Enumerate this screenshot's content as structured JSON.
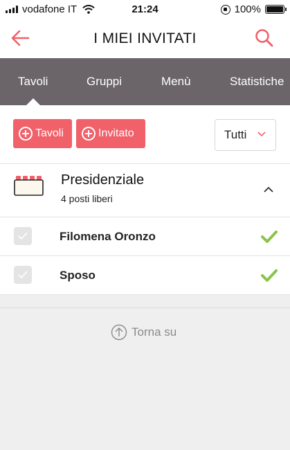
{
  "status_bar": {
    "carrier": "vodafone IT",
    "time": "21:24",
    "battery": "100%"
  },
  "nav": {
    "title": "I MIEI INVITATI"
  },
  "tabs": [
    {
      "label": "Tavoli",
      "active": true
    },
    {
      "label": "Gruppi",
      "active": false
    },
    {
      "label": "Menù",
      "active": false
    },
    {
      "label": "Statistiche",
      "active": false
    }
  ],
  "toolbar": {
    "add_table_label": "Tavoli",
    "add_guest_label": "Invitato",
    "filter_value": "Tutti"
  },
  "table": {
    "name": "Presidenziale",
    "seats_free": "4 posti liberi"
  },
  "guests": [
    {
      "name": "Filomena Oronzo",
      "confirmed": true
    },
    {
      "name": "Sposo",
      "confirmed": true
    }
  ],
  "footer": {
    "back_to_top": "Torna su"
  },
  "colors": {
    "accent": "#f0616a",
    "tab_bar": "#6b6468",
    "confirm_green": "#8bc34a",
    "background": "#efefef"
  }
}
